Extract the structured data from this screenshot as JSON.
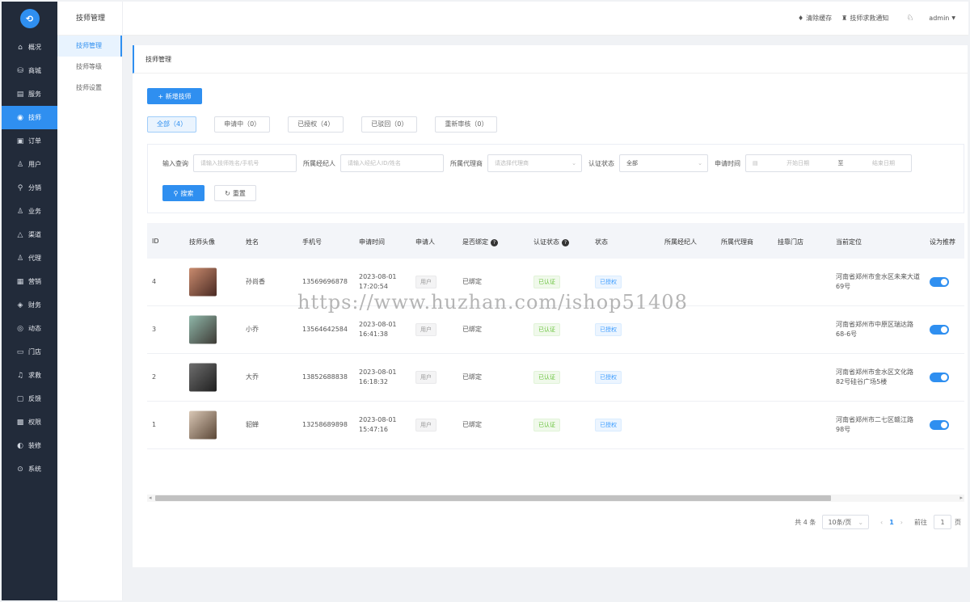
{
  "nav": {
    "logo_icon": "logo-icon",
    "items": [
      {
        "label": "概况",
        "icon": "home-icon",
        "glyph": "⌂"
      },
      {
        "label": "商城",
        "icon": "shop-icon",
        "glyph": "⛁"
      },
      {
        "label": "服务",
        "icon": "service-icon",
        "glyph": "▤"
      },
      {
        "label": "技师",
        "icon": "technician-icon",
        "glyph": "◉"
      },
      {
        "label": "订单",
        "icon": "order-icon",
        "glyph": "▣"
      },
      {
        "label": "用户",
        "icon": "user-icon",
        "glyph": "♙"
      },
      {
        "label": "分销",
        "icon": "distribution-icon",
        "glyph": "⚲"
      },
      {
        "label": "业务",
        "icon": "business-icon",
        "glyph": "♙"
      },
      {
        "label": "渠道",
        "icon": "channel-icon",
        "glyph": "△"
      },
      {
        "label": "代理",
        "icon": "agent-icon",
        "glyph": "♙"
      },
      {
        "label": "营销",
        "icon": "marketing-icon",
        "glyph": "▦"
      },
      {
        "label": "财务",
        "icon": "finance-icon",
        "glyph": "◈"
      },
      {
        "label": "动态",
        "icon": "dynamic-icon",
        "glyph": "◎"
      },
      {
        "label": "门店",
        "icon": "store-icon",
        "glyph": "▭"
      },
      {
        "label": "求救",
        "icon": "sos-icon",
        "glyph": "♫"
      },
      {
        "label": "反馈",
        "icon": "feedback-icon",
        "glyph": "▢"
      },
      {
        "label": "权限",
        "icon": "permission-icon",
        "glyph": "▩"
      },
      {
        "label": "装修",
        "icon": "decoration-icon",
        "glyph": "◐"
      },
      {
        "label": "系统",
        "icon": "system-icon",
        "glyph": "⊙"
      }
    ],
    "active_index": 3
  },
  "subnav": {
    "title": "技师管理",
    "items": [
      "技师管理",
      "技师等级",
      "技师设置"
    ],
    "active_index": 0
  },
  "header": {
    "clear_cache": "清除缓存",
    "help_notice": "技师求救通知",
    "user": "admin",
    "accent": "#2f8ff0"
  },
  "main": {
    "title": "技师管理",
    "add_button": "+ 新增技师",
    "tabs": [
      "全部（4）",
      "申请中（0）",
      "已授权（4）",
      "已驳回（0）",
      "重新审核（0）"
    ],
    "active_tab": 0
  },
  "filter": {
    "query_label": "输入查询",
    "query_placeholder": "请输入技师姓名/手机号",
    "broker_label": "所属经纪人",
    "broker_placeholder": "请输入经纪人ID/姓名",
    "agent_label": "所属代理商",
    "agent_placeholder": "请选择代理商",
    "status_label": "认证状态",
    "status_value": "全部",
    "time_label": "申请时间",
    "start_placeholder": "开始日期",
    "range_sep": "至",
    "end_placeholder": "结束日期",
    "search_button": "搜索",
    "reset_button": "重置"
  },
  "table": {
    "headers": [
      "ID",
      "技师头像",
      "姓名",
      "手机号",
      "申请时间",
      "申请人",
      "是否绑定",
      "认证状态",
      "状态",
      "所属经纪人",
      "所属代理商",
      "挂靠门店",
      "当前定位",
      "设为推荐"
    ],
    "rows": [
      {
        "id": "4",
        "name": "孙尚香",
        "phone": "13569696878",
        "date": "2023-08-01",
        "time": "17:20:54",
        "applicant": "用户",
        "bound": "已绑定",
        "cert": "已认证",
        "status": "已授权",
        "broker": "",
        "agent": "",
        "store": "",
        "location": "河南省郑州市金水区未来大道69号",
        "recommend": true,
        "avatar_colors": [
          "#c98b6e",
          "#4a2a23"
        ]
      },
      {
        "id": "3",
        "name": "小乔",
        "phone": "13564642584",
        "date": "2023-08-01",
        "time": "16:41:38",
        "applicant": "用户",
        "bound": "已绑定",
        "cert": "已认证",
        "status": "已授权",
        "broker": "",
        "agent": "",
        "store": "",
        "location": "河南省郑州市中原区瑞达路68-6号",
        "recommend": true,
        "avatar_colors": [
          "#8fb7a9",
          "#3d3a35"
        ]
      },
      {
        "id": "2",
        "name": "大乔",
        "phone": "13852688838",
        "date": "2023-08-01",
        "time": "16:18:32",
        "applicant": "用户",
        "bound": "已绑定",
        "cert": "已认证",
        "status": "已授权",
        "broker": "",
        "agent": "",
        "store": "",
        "location": "河南省郑州市金水区文化路82号硅谷广场5楼",
        "recommend": true,
        "avatar_colors": [
          "#6e6e6e",
          "#1f1f1f"
        ]
      },
      {
        "id": "1",
        "name": "貂蝉",
        "phone": "13258689898",
        "date": "2023-08-01",
        "time": "15:47:16",
        "applicant": "用户",
        "bound": "已绑定",
        "cert": "已认证",
        "status": "已授权",
        "broker": "",
        "agent": "",
        "store": "",
        "location": "河南省郑州市二七区赣江路98号",
        "recommend": true,
        "avatar_colors": [
          "#d9c7b5",
          "#5a4636"
        ]
      }
    ]
  },
  "pager": {
    "total": "共 4 条",
    "page_size": "10条/页",
    "current": "1",
    "goto_label": "前往",
    "goto_value": "1",
    "page_unit": "页"
  },
  "watermark": "https://www.huzhan.com/ishop51408"
}
